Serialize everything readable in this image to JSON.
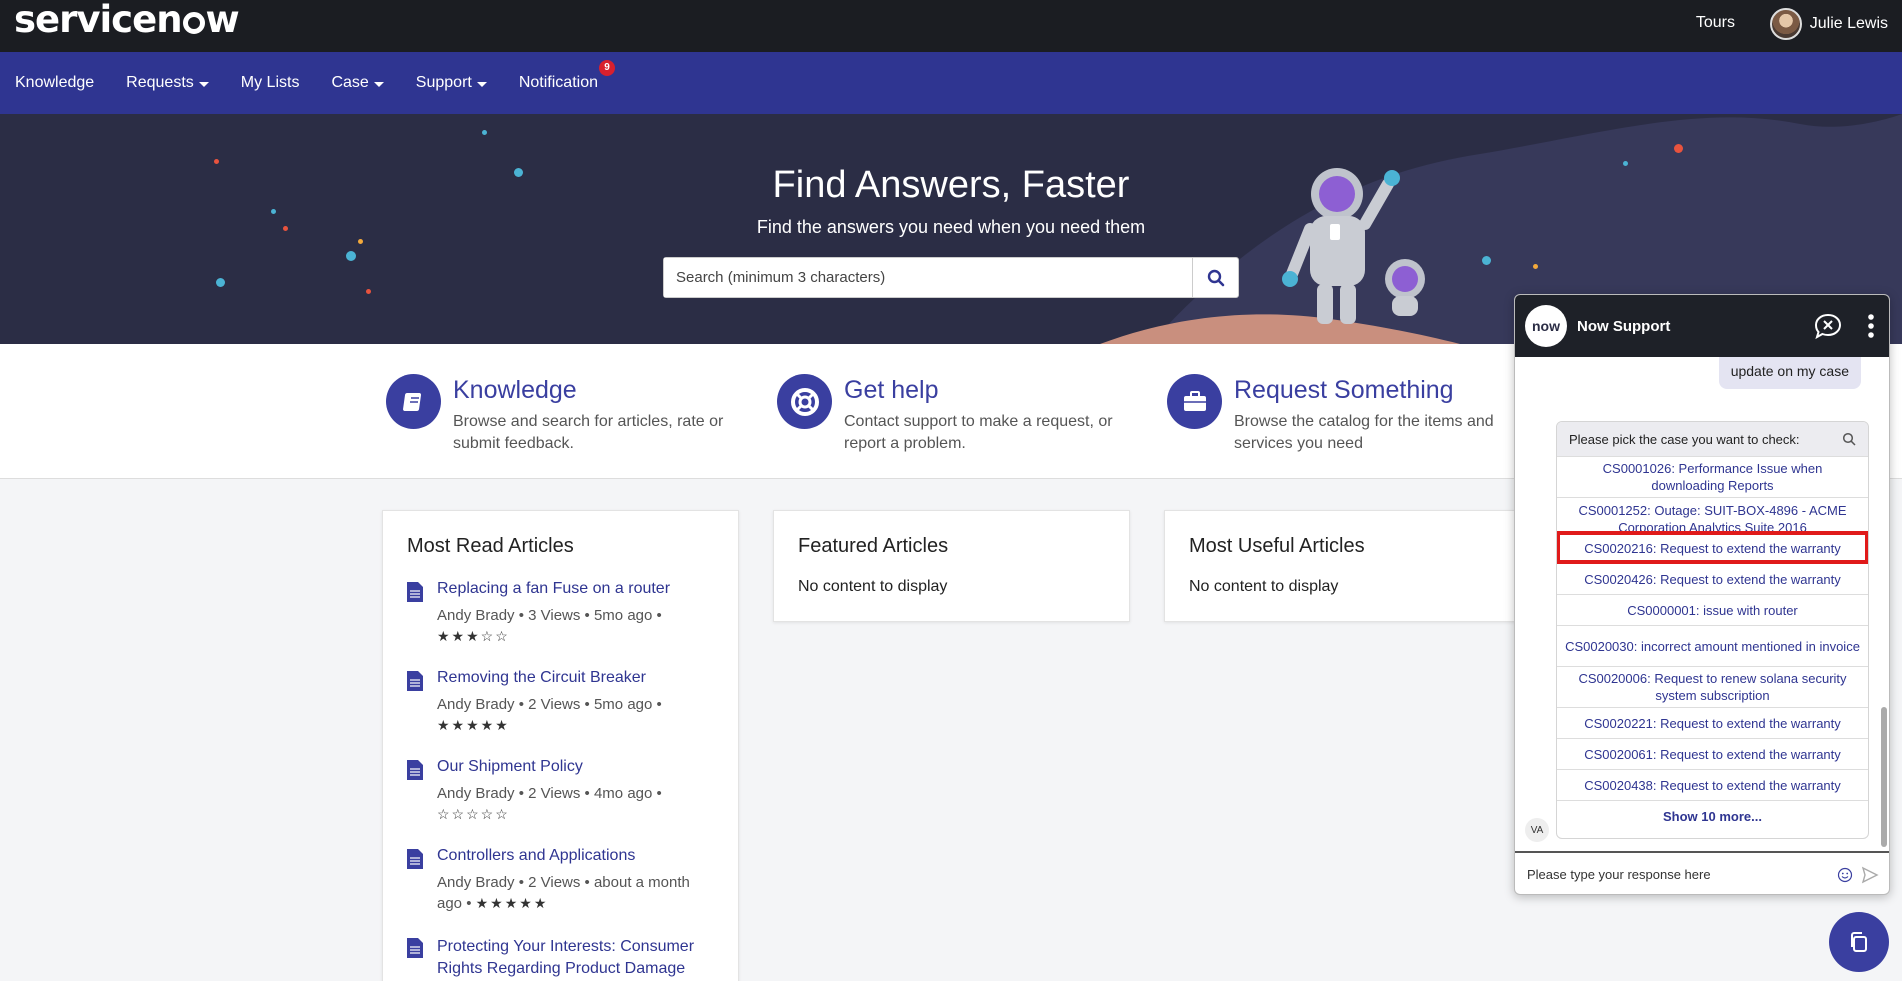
{
  "brand": {
    "logo_pre": "servicen",
    "logo_post": "w",
    "accent": "#2f3591"
  },
  "header": {
    "tours": "Tours",
    "user_name": "Julie Lewis"
  },
  "nav": {
    "items": [
      "Knowledge",
      "Requests",
      "My Lists",
      "Case",
      "Support",
      "Notification"
    ],
    "notification_count": "9"
  },
  "hero": {
    "title": "Find Answers, Faster",
    "subtitle": "Find the answers you need when you need them",
    "search_placeholder": "Search (minimum 3 characters)"
  },
  "categories": [
    {
      "title": "Knowledge",
      "desc": "Browse and search for articles, rate or submit feedback.",
      "icon": "book-icon"
    },
    {
      "title": "Get help",
      "desc": "Contact support to make a request, or report a problem.",
      "icon": "lifebuoy-icon"
    },
    {
      "title": "Request Something",
      "desc": "Browse the catalog for the items and services you need",
      "icon": "briefcase-icon"
    }
  ],
  "most_read": {
    "title": "Most Read Articles",
    "articles": [
      {
        "title": "Replacing a fan Fuse on a router",
        "meta": "Andy Brady  •  3 Views  •  5mo ago  •",
        "stars": "★★★☆☆"
      },
      {
        "title": "Removing the Circuit Breaker",
        "meta": "Andy Brady  •  2 Views  •  5mo ago  •",
        "stars": "★★★★★"
      },
      {
        "title": "Our Shipment Policy",
        "meta": "Andy Brady  •  2 Views  •  4mo ago  •",
        "stars": "☆☆☆☆☆"
      },
      {
        "title": "Controllers and Applications",
        "meta": "Andy Brady  •  2 Views  •  about a month ago  •",
        "stars": "★★★★★"
      },
      {
        "title": "Protecting Your Interests: Consumer Rights Regarding Product Damage",
        "meta": "",
        "stars": ""
      }
    ]
  },
  "featured": {
    "title": "Featured Articles",
    "empty": "No content to display"
  },
  "most_useful": {
    "title": "Most Useful Articles",
    "empty": "No content to display"
  },
  "chat": {
    "title": "Now Support",
    "logo_text": "now",
    "user_message": "update on my case",
    "picker_prompt": "Please pick the case you want to check:",
    "options": [
      "CS0001026: Performance Issue when downloading Reports",
      "CS0001252: Outage: SUIT-BOX-4896 - ACME Corporation Analytics Suite 2016",
      "CS0020216: Request to extend the warranty",
      "CS0020426: Request to extend the warranty",
      "CS0000001: issue with router",
      "CS0020030: incorrect amount mentioned in invoice",
      "CS0020006: Request to renew solana security system subscription",
      "CS0020221: Request to extend the warranty",
      "CS0020061: Request to extend the warranty",
      "CS0020438: Request to extend the warranty"
    ],
    "show_more": "Show 10 more...",
    "va_label": "VA",
    "input_placeholder": "Please type your response here"
  }
}
